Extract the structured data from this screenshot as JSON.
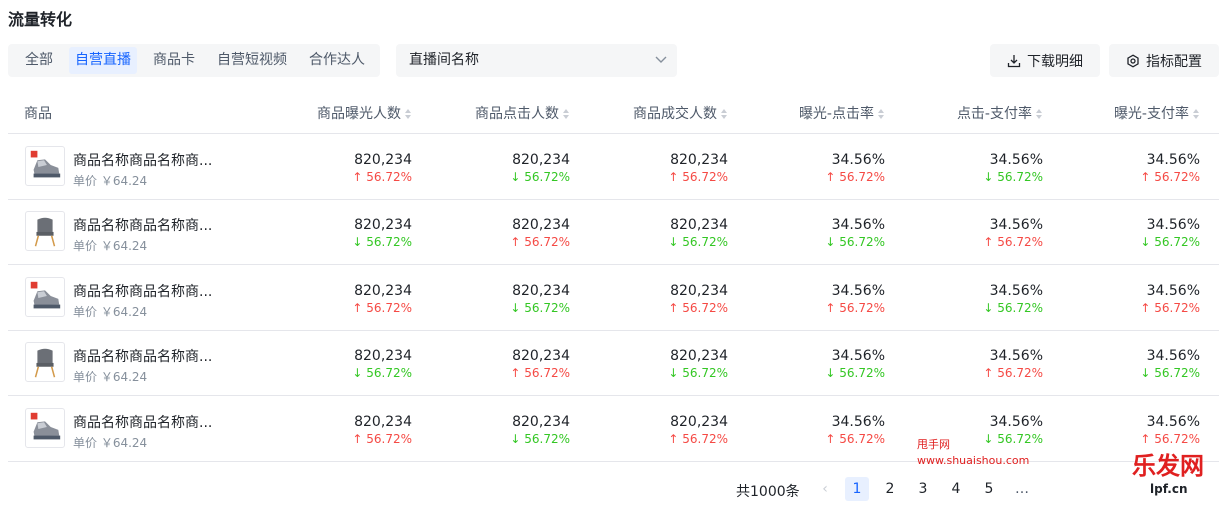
{
  "page": {
    "title": "流量转化"
  },
  "tabs": [
    {
      "label": "全部",
      "active": false
    },
    {
      "label": "自营直播",
      "active": true
    },
    {
      "label": "商品卡",
      "active": false
    },
    {
      "label": "自营短视频",
      "active": false
    },
    {
      "label": "合作达人",
      "active": false
    }
  ],
  "filter": {
    "select_value": "直播间名称",
    "chevron_icon": "chevron-down-icon"
  },
  "toolbar": {
    "download_label": "下载明细",
    "download_icon": "download-icon",
    "metrics_label": "指标配置",
    "metrics_icon": "settings-icon"
  },
  "table": {
    "headers": [
      "商品",
      "商品曝光人数",
      "商品点击人数",
      "商品成交人数",
      "曝光-点击率",
      "点击-支付率",
      "曝光-支付率"
    ],
    "rows": [
      {
        "image": "sneaker",
        "name": "商品名称商品名称商...",
        "price": "单价 ￥64.24",
        "cells": [
          {
            "value": "820,234",
            "change": "↑ 56.72%",
            "dir": "up"
          },
          {
            "value": "820,234",
            "change": "↓ 56.72%",
            "dir": "down"
          },
          {
            "value": "820,234",
            "change": "↑ 56.72%",
            "dir": "up"
          },
          {
            "value": "34.56%",
            "change": "↑ 56.72%",
            "dir": "up"
          },
          {
            "value": "34.56%",
            "change": "↓ 56.72%",
            "dir": "down"
          },
          {
            "value": "34.56%",
            "change": "↑ 56.72%",
            "dir": "up"
          }
        ]
      },
      {
        "image": "chair",
        "name": "商品名称商品名称商...",
        "price": "单价 ￥64.24",
        "cells": [
          {
            "value": "820,234",
            "change": "↓ 56.72%",
            "dir": "down"
          },
          {
            "value": "820,234",
            "change": "↑ 56.72%",
            "dir": "up"
          },
          {
            "value": "820,234",
            "change": "↓ 56.72%",
            "dir": "down"
          },
          {
            "value": "34.56%",
            "change": "↓ 56.72%",
            "dir": "down"
          },
          {
            "value": "34.56%",
            "change": "↑ 56.72%",
            "dir": "up"
          },
          {
            "value": "34.56%",
            "change": "↓ 56.72%",
            "dir": "down"
          }
        ]
      },
      {
        "image": "sneaker",
        "name": "商品名称商品名称商...",
        "price": "单价 ￥64.24",
        "cells": [
          {
            "value": "820,234",
            "change": "↑ 56.72%",
            "dir": "up"
          },
          {
            "value": "820,234",
            "change": "↓ 56.72%",
            "dir": "down"
          },
          {
            "value": "820,234",
            "change": "↑ 56.72%",
            "dir": "up"
          },
          {
            "value": "34.56%",
            "change": "↑ 56.72%",
            "dir": "up"
          },
          {
            "value": "34.56%",
            "change": "↓ 56.72%",
            "dir": "down"
          },
          {
            "value": "34.56%",
            "change": "↑ 56.72%",
            "dir": "up"
          }
        ]
      },
      {
        "image": "chair",
        "name": "商品名称商品名称商...",
        "price": "单价 ￥64.24",
        "cells": [
          {
            "value": "820,234",
            "change": "↓ 56.72%",
            "dir": "down"
          },
          {
            "value": "820,234",
            "change": "↑ 56.72%",
            "dir": "up"
          },
          {
            "value": "820,234",
            "change": "↓ 56.72%",
            "dir": "down"
          },
          {
            "value": "34.56%",
            "change": "↓ 56.72%",
            "dir": "down"
          },
          {
            "value": "34.56%",
            "change": "↑ 56.72%",
            "dir": "up"
          },
          {
            "value": "34.56%",
            "change": "↓ 56.72%",
            "dir": "down"
          }
        ]
      },
      {
        "image": "sneaker",
        "name": "商品名称商品名称商...",
        "price": "单价 ￥64.24",
        "cells": [
          {
            "value": "820,234",
            "change": "↑ 56.72%",
            "dir": "up"
          },
          {
            "value": "820,234",
            "change": "↓ 56.72%",
            "dir": "down"
          },
          {
            "value": "820,234",
            "change": "↑ 56.72%",
            "dir": "up"
          },
          {
            "value": "34.56%",
            "change": "↑ 56.72%",
            "dir": "up"
          },
          {
            "value": "34.56%",
            "change": "↓ 56.72%",
            "dir": "down"
          },
          {
            "value": "34.56%",
            "change": "↑ 56.72%",
            "dir": "up"
          }
        ]
      }
    ]
  },
  "pagination": {
    "total": "共1000条",
    "prev_icon": "chevron-left-icon",
    "pages": [
      "1",
      "2",
      "3",
      "4",
      "5"
    ],
    "current": "1",
    "ellipsis": "…"
  },
  "colors": {
    "accent": "#1664ff",
    "up": "#f54a45",
    "down": "#34c724"
  },
  "watermark": {
    "line1": "甩手网",
    "line2": "www.shuaishou.com",
    "logo_text": "乐发网",
    "logo_sub": "lpf.cn"
  }
}
